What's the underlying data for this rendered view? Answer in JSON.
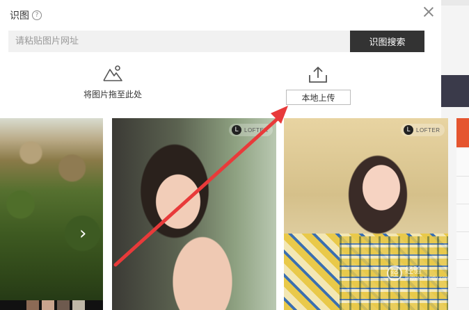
{
  "dialog": {
    "title": "识图",
    "help_glyph": "?",
    "search": {
      "placeholder": "请粘贴图片网址",
      "button_label": "识图搜索"
    },
    "drop_label": "将图片拖至此处",
    "upload_label": "本地上传"
  },
  "cards": {
    "badge_text": "LOFTER",
    "badge_glyph": "L",
    "nav_glyph": "›"
  },
  "watermark": {
    "glyph": "经",
    "text": "经验",
    "subtext": "jingyan.baidu.com"
  },
  "colors": {
    "search_button_bg": "#333333",
    "arrow_red": "#e83a3a",
    "accent_orange": "#e5552f"
  }
}
